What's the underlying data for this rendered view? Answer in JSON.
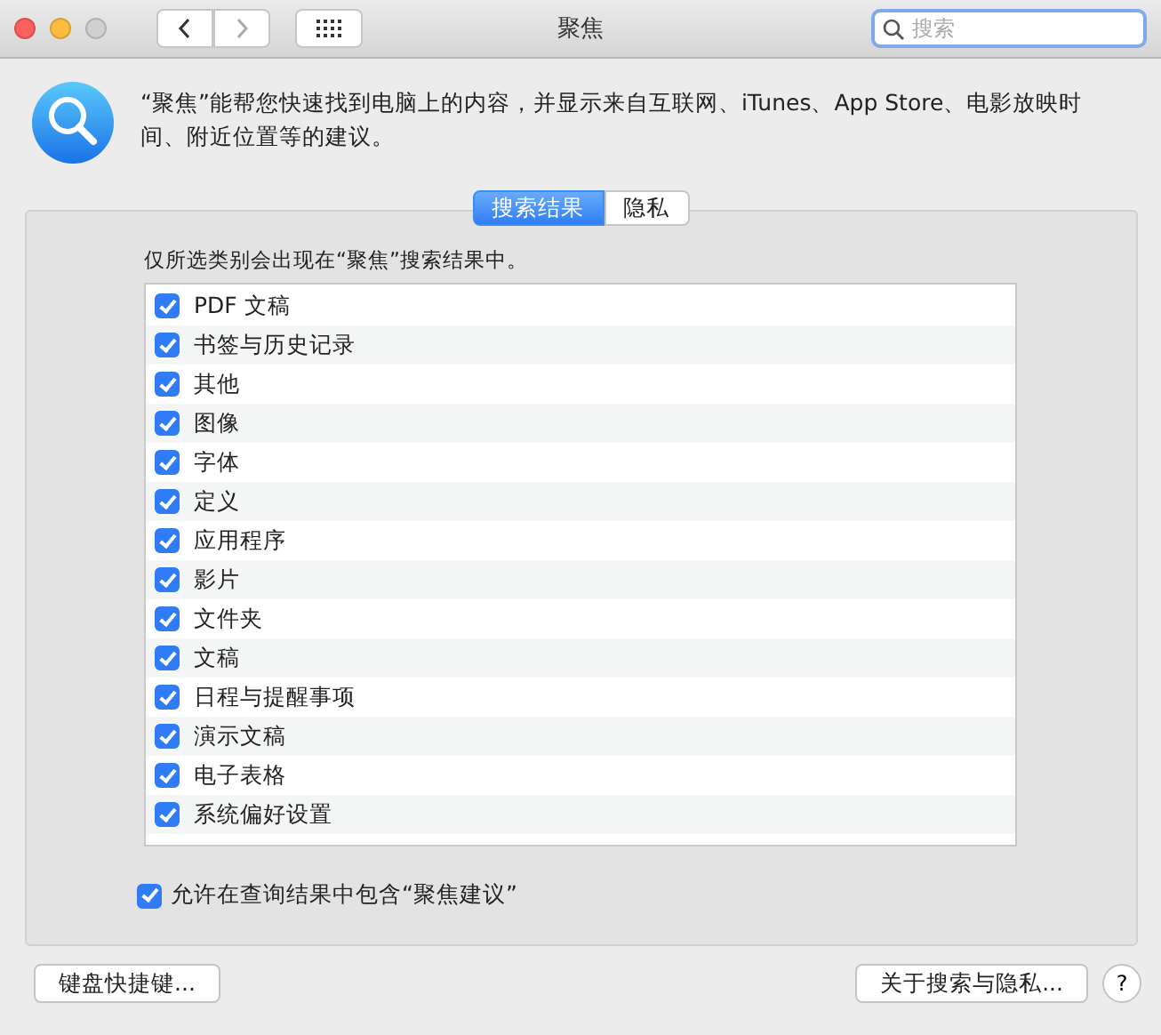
{
  "window": {
    "title": "聚焦"
  },
  "search": {
    "placeholder": "搜索"
  },
  "description": "“聚焦”能帮您快速找到电脑上的内容，并显示来自互联网、iTunes、App Store、电影放映时间、附近位置等的建议。",
  "tabs": [
    {
      "label": "搜索结果",
      "selected": true
    },
    {
      "label": "隐私",
      "selected": false
    }
  ],
  "hint": "仅所选类别会出现在“聚焦”搜索结果中。",
  "categories": [
    {
      "label": "PDF 文稿",
      "checked": true
    },
    {
      "label": "书签与历史记录",
      "checked": true
    },
    {
      "label": "其他",
      "checked": true
    },
    {
      "label": "图像",
      "checked": true
    },
    {
      "label": "字体",
      "checked": true
    },
    {
      "label": "定义",
      "checked": true
    },
    {
      "label": "应用程序",
      "checked": true
    },
    {
      "label": "影片",
      "checked": true
    },
    {
      "label": "文件夹",
      "checked": true
    },
    {
      "label": "文稿",
      "checked": true
    },
    {
      "label": "日程与提醒事项",
      "checked": true
    },
    {
      "label": "演示文稿",
      "checked": true
    },
    {
      "label": "电子表格",
      "checked": true
    },
    {
      "label": "系统偏好设置",
      "checked": true
    }
  ],
  "allow_suggestions": {
    "label": "允许在查询结果中包含“聚焦建议”",
    "checked": true
  },
  "buttons": {
    "left": "键盘快捷键...",
    "right": "关于搜索与隐私...",
    "help": "?"
  }
}
